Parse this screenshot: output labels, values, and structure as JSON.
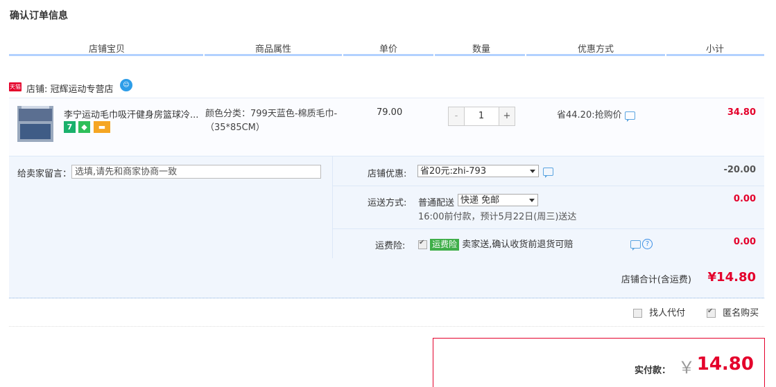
{
  "page_title": "确认订单信息",
  "columns": [
    "店铺宝贝",
    "商品属性",
    "单价",
    "数量",
    "优惠方式",
    "小计"
  ],
  "shop": {
    "tag": "天猫",
    "label": "店铺: 冠辉运动专营店",
    "chat_icon": "wangwang-icon"
  },
  "item": {
    "title": "李宁运动毛巾吸汗健身房篮球冷...",
    "badges": [
      {
        "text": "7",
        "color": "#1ab16c"
      },
      {
        "text": "◆",
        "color": "#2fbf5a"
      },
      {
        "text": "▬",
        "color": "#f5a623"
      }
    ],
    "attribute": "颜色分类：799天蓝色-棉质毛巾-（35*85CM）",
    "unit_price": "79.00",
    "quantity": "1",
    "qty_minus": "-",
    "qty_plus": "+",
    "promo": "省44.20:抢购价",
    "subtotal": "34.80"
  },
  "options": {
    "memo_label": "给卖家留言：",
    "memo_placeholder": "选填,请先和商家协商一致",
    "shop_discount_label": "店铺优惠:",
    "shop_discount_value": "省20元:zhi-793",
    "shop_discount_amount": "-20.00",
    "shipping_label": "运送方式:",
    "shipping_method": "普通配送",
    "shipping_select": "快递 免邮",
    "shipping_note": "16:00前付款，预计5月22日(周三)送达",
    "shipping_amount": "0.00",
    "insurance_label": "运费险:",
    "insurance_tag": "运费险",
    "insurance_text": "卖家送,确认收货前退货可赔",
    "insurance_amount": "0.00"
  },
  "shop_total": {
    "label": "店铺合计(含运费)",
    "value": "¥14.80"
  },
  "extras": {
    "pay_for_me": "找人代付",
    "anonymous": "匿名购买"
  },
  "pay": {
    "label": "实付款：",
    "currency": "￥",
    "value": "14.80"
  },
  "colors": {
    "accent_red": "#e4002b",
    "header_line": "#b2d1ff",
    "panel_bg": "#f1f6fd"
  }
}
